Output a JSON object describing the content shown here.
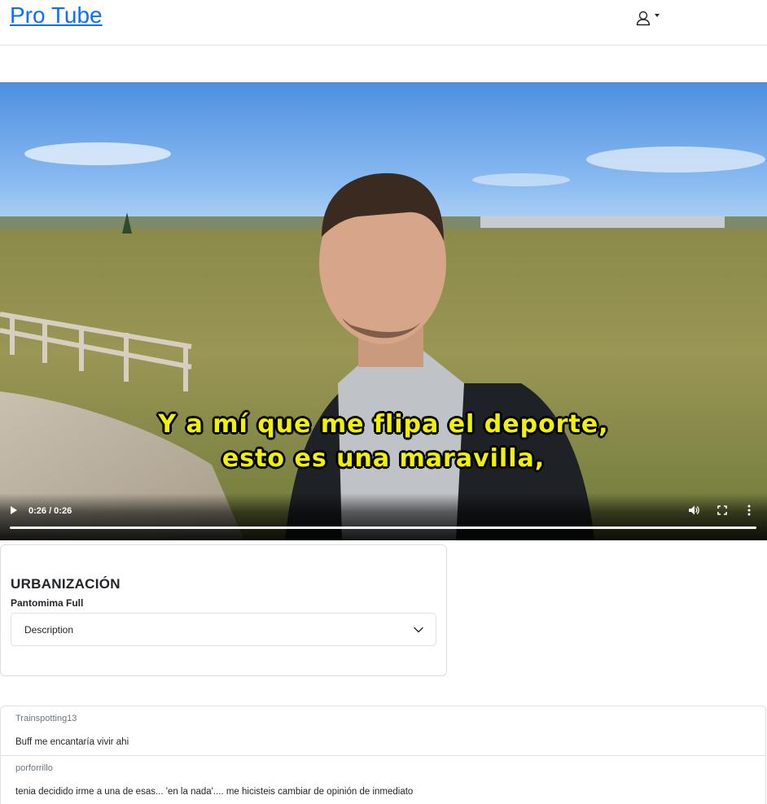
{
  "navbar": {
    "brand": "Pro Tube",
    "user_icon": "user-icon",
    "dropdown_icon": "caret-down-icon"
  },
  "player": {
    "subtitle_line1": "Y a mí que me flipa el deporte,",
    "subtitle_line2": "esto es una maravilla,",
    "time": "0:26 / 0:26",
    "progress": 1.0,
    "icons": [
      "play-icon",
      "volume-icon",
      "fullscreen-icon",
      "more-options-icon"
    ]
  },
  "video_info": {
    "title": "URBANIZACIÓN",
    "channel": "Pantomima Full",
    "description_label": "Description"
  },
  "comments": [
    {
      "author": "Trainspotting13",
      "text": "Buff me encantaría vivir ahi"
    },
    {
      "author": "porforrillo",
      "text": "tenia decidido irme a una de esas... 'en la nada'.... me hicisteis cambiar de opinión de inmediato"
    }
  ],
  "colors": {
    "brand": "#0d6efd",
    "subtitle": "#f2f200",
    "border": "#dee2e6"
  }
}
